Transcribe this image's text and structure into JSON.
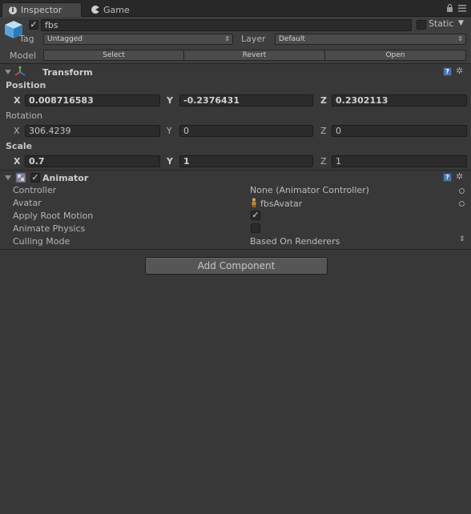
{
  "tabs": [
    {
      "label": "Inspector",
      "icon": "info-icon"
    },
    {
      "label": "Game",
      "icon": "pacman-icon"
    }
  ],
  "header": {
    "active": true,
    "name": "fbs",
    "static_label": "Static",
    "tag_label": "Tag",
    "tag_value": "Untagged",
    "layer_label": "Layer",
    "layer_value": "Default",
    "model_label": "Model",
    "model_buttons": [
      "Select",
      "Revert",
      "Open"
    ]
  },
  "transform": {
    "title": "Transform",
    "position": {
      "label": "Position",
      "x": "0.008716583",
      "y": "-0.2376431",
      "z": "0.2302113"
    },
    "rotation": {
      "label": "Rotation",
      "x": "306.4239",
      "y": "0",
      "z": "0"
    },
    "scale": {
      "label": "Scale",
      "x": "0.7",
      "y": "1",
      "z": "1"
    },
    "axes": [
      "X",
      "Y",
      "Z"
    ]
  },
  "animator": {
    "title": "Animator",
    "enabled": true,
    "properties": [
      {
        "label": "Controller",
        "value": "None (Animator Controller)"
      },
      {
        "label": "Avatar",
        "value": "fbsAvatar"
      },
      {
        "label": "Apply Root Motion",
        "checked": true
      },
      {
        "label": "Animate Physics",
        "checked": false
      },
      {
        "label": "Culling Mode",
        "value": "Based On Renderers"
      }
    ]
  },
  "add_component_label": "Add Component",
  "colors": {
    "background": "#383838",
    "field": "#2b2b2b",
    "help": "#4a74ad"
  }
}
